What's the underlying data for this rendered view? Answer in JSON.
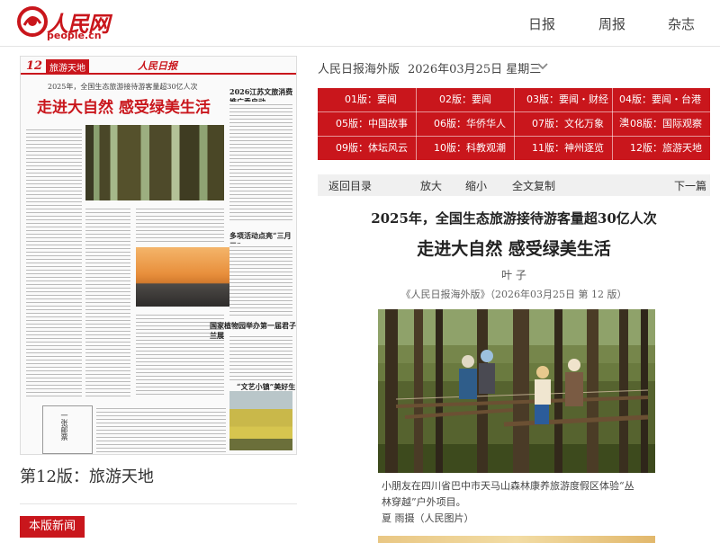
{
  "header": {
    "logo_text": "人民网",
    "logo_sub": "people.cn",
    "nav": [
      "日报",
      "周报",
      "杂志"
    ]
  },
  "thumbnail": {
    "page_number": "12",
    "section": "旅游天地",
    "brand": "人民日报",
    "kicker": "2025年，全国生态旅游接待游客量超30亿人次",
    "headline": "走进大自然  感受绿美生活",
    "col_title_1": "2026江苏文旅消费推广季启动",
    "col_title_2": "多项活动点亮“三月三”",
    "col_title_3": "国家植物园举办第一届君子兰展",
    "col_title_4": "“文艺小镇”美好生活",
    "box_text": "一张邮票"
  },
  "page_label": "第12版：旅游天地",
  "news_button": "本版新闻",
  "edition": {
    "name": "人民日报海外版",
    "date": "2026年03月25日  星期三"
  },
  "pages": [
    "01版：要闻",
    "02版：要闻",
    "03版：要闻・财经",
    "04版：要闻・台港澳",
    "05版：中国故事",
    "06版：华侨华人",
    "07版：文化万象",
    "08版：国际观察",
    "09版：体坛风云",
    "10版：科教观潮",
    "11版：神州逐览",
    "12版：旅游天地"
  ],
  "toolbar": {
    "back": "返回目录",
    "zoom_in": "放大",
    "zoom_out": "缩小",
    "copy": "全文复制",
    "next": "下一篇"
  },
  "article": {
    "kicker": "2025年，全国生态旅游接待游客量超30亿人次",
    "title": "走进大自然  感受绿美生活",
    "author": "叶  子",
    "source": "《人民日报海外版》（2026年03月25日   第  12  版）",
    "caption_1": "小朋友在四川省巴中市天马山森林康养旅游度假区体验“丛",
    "caption_2": "林穿越”户外项目。",
    "caption_3": "夏  雨摄（人民图片）"
  },
  "colors": {
    "brand_red": "#c9161c",
    "toolbar_bg": "#f0f0f0"
  }
}
